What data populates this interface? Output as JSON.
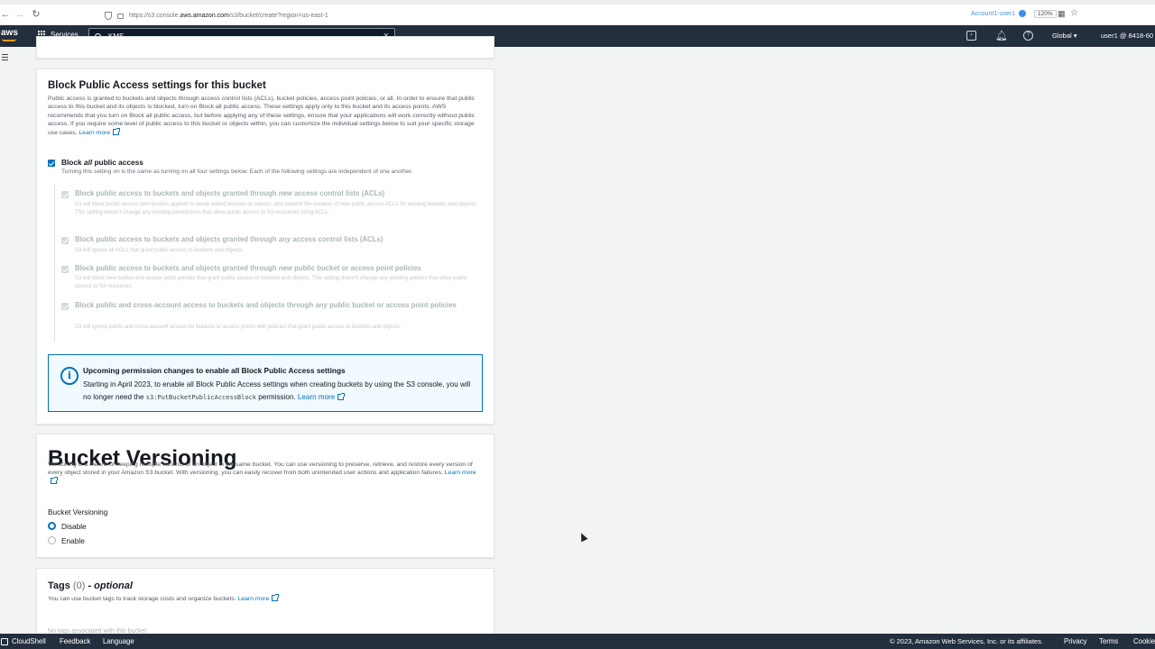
{
  "browser": {
    "url_prefix": "https://s3.console.",
    "url_domain": "aws.amazon.com",
    "url_path": "/s3/bucket/create?region=us-east-1",
    "account_pill": "Account1-user1",
    "zoom": "120%"
  },
  "header": {
    "logo": "aws",
    "services_label": "Services",
    "search_value": "KMS",
    "region": "Global ▾",
    "user": "user1 @ 8418-60"
  },
  "block_public_access": {
    "title": "Block Public Access settings for this bucket",
    "description": "Public access is granted to buckets and objects through access control lists (ACLs), bucket policies, access point policies, or all. In order to ensure that public access to this bucket and its objects is blocked, turn on Block all public access. These settings apply only to this bucket and its access points. AWS recommends that you turn on Block all public access, but before applying any of these settings, ensure that your applications will work correctly without public access. If you require some level of public access to this bucket or objects within, you can customize the individual settings below to suit your specific storage use cases.",
    "learn_more": "Learn more",
    "block_all_prefix": "Block ",
    "block_all_em": "all",
    "block_all_suffix": " public access",
    "block_all_desc": "Turning this setting on is the same as turning on all four settings below. Each of the following settings are independent of one another.",
    "settings": [
      {
        "title_a": "Block public access to buckets and objects granted through ",
        "title_em": "new",
        "title_b": " access control lists (ACLs)",
        "desc": "S3 will block public access permissions applied to newly added buckets or objects, and prevent the creation of new public access ACLs for existing buckets and objects. This setting doesn't change any existing permissions that allow public access to S3 resources using ACLs."
      },
      {
        "title_a": "Block public access to buckets and objects granted through ",
        "title_em": "any",
        "title_b": " access control lists (ACLs)",
        "desc": "S3 will ignore all ACLs that grant public access to buckets and objects."
      },
      {
        "title_a": "Block public access to buckets and objects granted through ",
        "title_em": "new",
        "title_b": " public bucket or access point policies",
        "desc": "S3 will block new bucket and access point policies that grant public access to buckets and objects. This setting doesn't change any existing policies that allow public access to S3 resources."
      },
      {
        "title_a": "Block public and cross-account access to buckets and objects through ",
        "title_em": "any",
        "title_b": " public bucket or access point policies",
        "desc": "S3 will ignore public and cross-account access for buckets or access points with policies that grant public access to buckets and objects."
      }
    ]
  },
  "info_box": {
    "title": "Upcoming permission changes to enable all Block Public Access settings",
    "body_a": "Starting in April 2023, to enable all Block Public Access settings when creating buckets by using the S3 console, you will no longer need the ",
    "body_code": "s3:PutBucketPublicAccessBlock",
    "body_b": " permission.",
    "learn_more": "Learn more"
  },
  "versioning": {
    "title": "Bucket Versioning",
    "description": "Versioning is a means of keeping multiple variants of an object in the same bucket. You can use versioning to preserve, retrieve, and restore every version of every object stored in your Amazon S3 bucket. With versioning, you can easily recover from both unintended user actions and application failures.",
    "learn_more": "Learn more",
    "field_label": "Bucket Versioning",
    "options": [
      "Disable",
      "Enable"
    ],
    "selected": "Disable"
  },
  "tags": {
    "title": "Tags",
    "count": "(0)",
    "optional": "- optional",
    "description": "You can use bucket tags to track storage costs and organize buckets.",
    "learn_more": "Learn more",
    "empty_text": "No tags associated with this bucket."
  },
  "footer": {
    "cloudshell": "CloudShell",
    "feedback": "Feedback",
    "language": "Language",
    "copyright": "© 2023, Amazon Web Services, Inc. or its affiliates.",
    "privacy": "Privacy",
    "terms": "Terms",
    "cookies": "Cookie"
  }
}
